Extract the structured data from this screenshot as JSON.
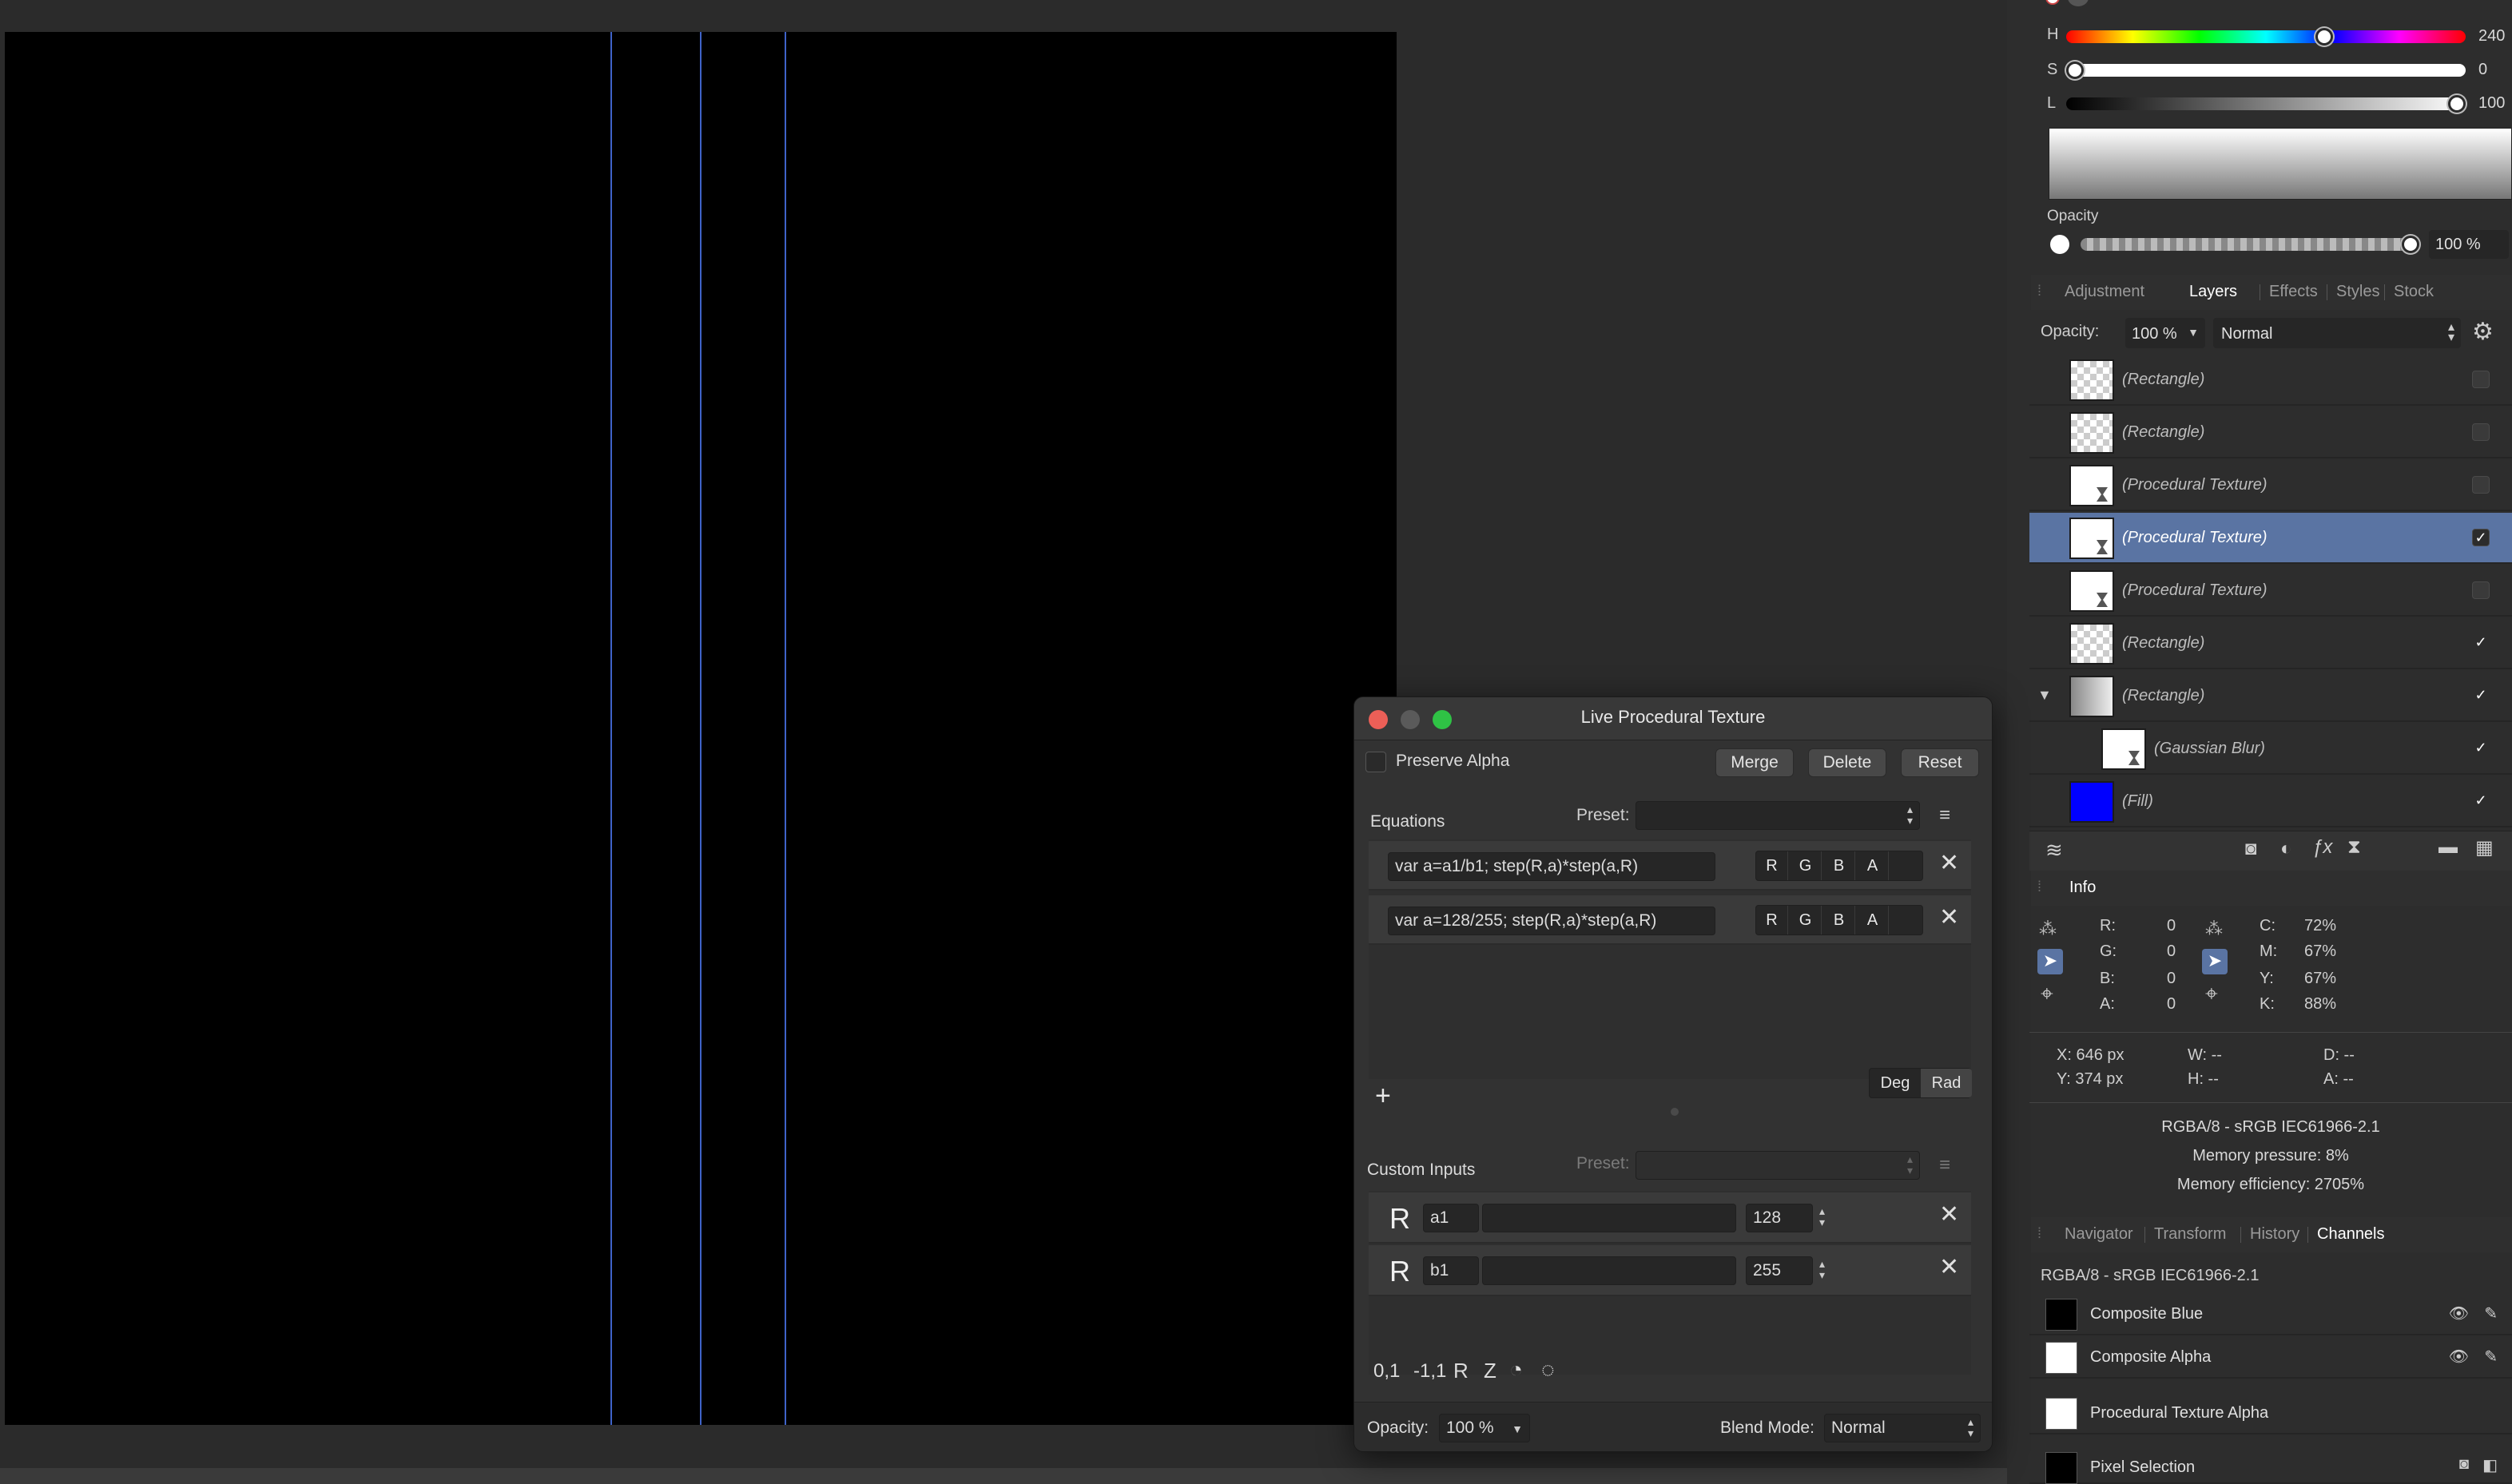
{
  "color_panel": {
    "h_label": "H",
    "h_value": "240",
    "s_label": "S",
    "s_value": "0",
    "l_label": "L",
    "l_value": "100",
    "opacity_label": "Opacity",
    "opacity_value": "100 %"
  },
  "tabs_top": [
    "Adjustment",
    "Layers",
    "Effects",
    "Styles",
    "Stock"
  ],
  "layers_header": {
    "opacity_label": "Opacity:",
    "opacity_value": "100 %",
    "blend_mode": "Normal"
  },
  "layers": [
    {
      "name": "(Rectangle)",
      "thumb": "checker",
      "checked": false
    },
    {
      "name": "(Rectangle)",
      "thumb": "checker",
      "checked": false
    },
    {
      "name": "(Procedural Texture)",
      "thumb": "white",
      "checked": false
    },
    {
      "name": "(Procedural Texture)",
      "thumb": "white",
      "checked": true,
      "selected": true
    },
    {
      "name": "(Procedural Texture)",
      "thumb": "white",
      "checked": false
    },
    {
      "name": "(Rectangle)",
      "thumb": "checker",
      "checked": true
    },
    {
      "name": "(Rectangle)",
      "thumb": "gray",
      "checked": true,
      "expanded": true
    },
    {
      "name": "(Gaussian Blur)",
      "thumb": "white",
      "checked": true,
      "child": true
    },
    {
      "name": "(Fill)",
      "thumb": "blue",
      "checked": true
    }
  ],
  "info": {
    "title": "Info",
    "r_label": "R:",
    "r": "0",
    "g_label": "G:",
    "g": "0",
    "b_label": "B:",
    "b": "0",
    "a_label": "A:",
    "a": "0",
    "c_label": "C:",
    "c": "72%",
    "m_label": "M:",
    "m": "67%",
    "y_label": "Y:",
    "y": "67%",
    "k_label": "K:",
    "k": "88%",
    "x_pos": "X: 646 px",
    "y_pos": "Y: 374 px",
    "w": "W: --",
    "h": "H: --",
    "d": "D: --",
    "angle": "A: --",
    "profile": "RGBA/8 - sRGB IEC61966-2.1",
    "mem_pressure": "Memory pressure: 8%",
    "mem_eff": "Memory efficiency: 2705%"
  },
  "tabs_bottom": [
    "Navigator",
    "Transform",
    "History",
    "Channels"
  ],
  "channels": {
    "profile": "RGBA/8 - sRGB IEC61966-2.1",
    "items": [
      "Composite Blue",
      "Composite Alpha",
      "Procedural Texture Alpha",
      "Pixel Selection"
    ]
  },
  "dialog": {
    "title": "Live Procedural Texture",
    "preserve_alpha": "Preserve Alpha",
    "merge": "Merge",
    "delete": "Delete",
    "reset": "Reset",
    "equations_label": "Equations",
    "preset_label": "Preset:",
    "equations": [
      "var a=a1/b1; step(R,a)*step(a,R)",
      "var a=128/255; step(R,a)*step(a,R)"
    ],
    "channels": [
      "R",
      "G",
      "B",
      "A"
    ],
    "add": "+",
    "deg": "Deg",
    "rad": "Rad",
    "custom_inputs_label": "Custom Inputs",
    "custom_inputs": [
      {
        "type": "R",
        "name": "a1",
        "value": "128"
      },
      {
        "type": "R",
        "name": "b1",
        "value": "255"
      }
    ],
    "tools": [
      "0,1",
      "-1,1",
      "R",
      "Z"
    ],
    "opacity_label": "Opacity:",
    "opacity_value": "100 %",
    "blend_label": "Blend Mode:",
    "blend_value": "Normal"
  },
  "colors": {
    "accent": "#5a74a3",
    "guide": "#3f63c8",
    "fill_layer": "#0000ff"
  }
}
